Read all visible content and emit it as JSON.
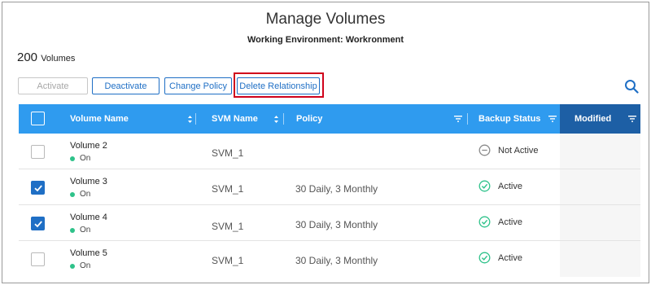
{
  "header": {
    "title": "Manage Volumes",
    "subtitle": "Working Environment: Workronment"
  },
  "summary": {
    "count": "200",
    "count_label": "Volumes"
  },
  "toolbar": {
    "activate_label": "Activate",
    "deactivate_label": "Deactivate",
    "change_policy_label": "Change Policy",
    "delete_relationship_label": "Delete Relationship"
  },
  "icons": {
    "search": "search-icon",
    "sort": "sort-icon",
    "filter": "filter-icon"
  },
  "colors": {
    "header_bg": "#2f9bef",
    "header_active": "#1d5fa5",
    "accent": "#1f6fc5",
    "highlight": "#d0021b",
    "on_dot": "#2ec28a",
    "active_status": "#2ec28a"
  },
  "table": {
    "columns": {
      "volume_name": "Volume Name",
      "svm_name": "SVM Name",
      "policy": "Policy",
      "backup_status": "Backup Status",
      "modified": "Modified"
    },
    "rows": [
      {
        "name": "Volume 2",
        "state": "On",
        "svm": "SVM_1",
        "policy": "",
        "status": "Not Active",
        "checked": false
      },
      {
        "name": "Volume 3",
        "state": "On",
        "svm": "SVM_1",
        "policy": "30 Daily, 3 Monthly",
        "status": "Active",
        "checked": true
      },
      {
        "name": "Volume 4",
        "state": "On",
        "svm": "SVM_1",
        "policy": "30 Daily, 3 Monthly",
        "status": "Active",
        "checked": true
      },
      {
        "name": "Volume 5",
        "state": "On",
        "svm": "SVM_1",
        "policy": "30 Daily, 3 Monthly",
        "status": "Active",
        "checked": false
      }
    ]
  }
}
